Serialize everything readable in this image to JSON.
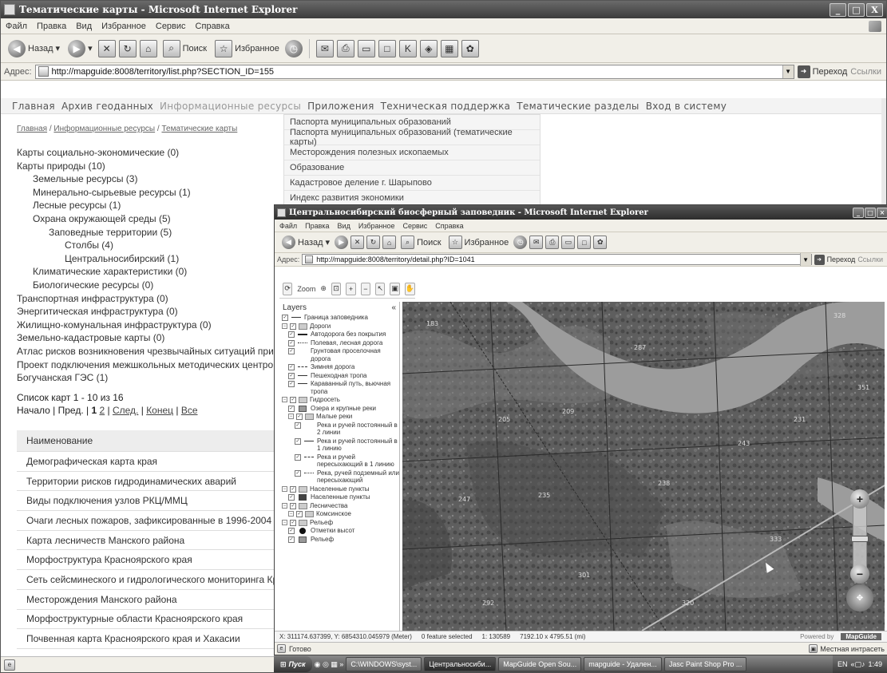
{
  "main_window": {
    "title": "Тематические карты - Microsoft Internet Explorer",
    "menu": [
      "Файл",
      "Правка",
      "Вид",
      "Избранное",
      "Сервис",
      "Справка"
    ],
    "toolbar": {
      "back": "Назад",
      "search": "Поиск",
      "favorites": "Избранное"
    },
    "address_label": "Адрес:",
    "address": "http://mapguide:8008/territory/list.php?SECTION_ID=155",
    "go": "Переход",
    "links": "Ссылки",
    "status": ""
  },
  "site_nav": [
    "Главная",
    "Архив геоданных",
    "Информационные ресурсы",
    "Приложения",
    "Техническая поддержка",
    "Тематические разделы",
    "Вход в систему"
  ],
  "breadcrumb": [
    "Главная",
    "Информационные ресурсы",
    "Тематические карты"
  ],
  "breadcrumb_sep": " / ",
  "dropdown": [
    "Паспорта муниципальных образований",
    "Паспорта муниципальных образований (тематические карты)",
    "Месторождения полезных ископаемых",
    "Образование",
    "Кадастровое деление г. Шарыпово",
    "Индекс развития экономики"
  ],
  "tree": [
    {
      "level": 0,
      "text": "Карты социально-экономические (0)"
    },
    {
      "level": 0,
      "text": "Карты природы (10)"
    },
    {
      "level": 1,
      "text": "Земельные ресурсы (3)"
    },
    {
      "level": 1,
      "text": "Минерально-сырьевые ресурсы (1)"
    },
    {
      "level": 1,
      "text": "Лесные ресурсы (1)"
    },
    {
      "level": 1,
      "text": "Охрана окружающей среды (5)"
    },
    {
      "level": 2,
      "text": "Заповедные территории (5)"
    },
    {
      "level": 3,
      "text": "Столбы (4)"
    },
    {
      "level": 3,
      "text": "Центральносибирский (1)"
    },
    {
      "level": 1,
      "text": "Климатические характеристики (0)"
    },
    {
      "level": 1,
      "text": "Биологические ресурсы (0)"
    },
    {
      "level": 0,
      "text": "Транспортная инфраструктура (0)"
    },
    {
      "level": 0,
      "text": "Энергитическая инфраструктура (0)"
    },
    {
      "level": 0,
      "text": "Жилищно-комунальная инфраструктура (0)"
    },
    {
      "level": 0,
      "text": "Земельно-кадастровые карты (0)"
    },
    {
      "level": 0,
      "text": "Атлас рисков возникновения чрезвычайных ситуаций при"
    },
    {
      "level": 0,
      "text": "Проект подключения межшкольных методических центро"
    },
    {
      "level": 0,
      "text": "Богучанская ГЭС (1)"
    }
  ],
  "pagination": {
    "summary": "Список карт 1 - 10 из 16",
    "first": "Начало",
    "prev": "Пред.",
    "current": "1",
    "page2": "2",
    "next": "След.",
    "last": "Конец",
    "all": "Все"
  },
  "table": {
    "header": "Наименование",
    "rows": [
      "Демографическая карта края",
      "Территории рисков гидродинамических аварий",
      "Виды подключения узлов РКЦ/ММЦ",
      "Очаги лесных пожаров, зафиксированные в 1996-2004 гг",
      "Карта лесничеств Манского района",
      "Морфоструктура Красноярского края",
      "Сеть сейсминеского и гидрологического мониторинга Кр",
      "Месторождения Манского района",
      "Морфоструктурные области Красноярского края",
      "Почвенная карта Красноярского края и Хакасии"
    ]
  },
  "front_window": {
    "title": "Центральносибирский биосферный заповедник - Microsoft Internet Explorer",
    "menu": [
      "Файл",
      "Правка",
      "Вид",
      "Избранное",
      "Сервис",
      "Справка"
    ],
    "toolbar": {
      "back": "Назад",
      "search": "Поиск",
      "favorites": "Избранное"
    },
    "address_label": "Адрес:",
    "address": "http://mapguide:8008/territory/detail.php?ID=1041",
    "go": "Переход",
    "links": "Ссылки",
    "zoom_label": "Zoom",
    "layers_title": "Layers",
    "layers": [
      {
        "indent": 0,
        "sym": "line",
        "text": "Граница заповедника"
      },
      {
        "indent": 0,
        "sym": "group",
        "text": "Дороги"
      },
      {
        "indent": 1,
        "sym": "thick",
        "text": "Автодорога без покрытия"
      },
      {
        "indent": 1,
        "sym": "dot",
        "text": "Полевая, лесная дорога"
      },
      {
        "indent": 1,
        "sym": "none",
        "text": "Грунтовая проселочная дорога"
      },
      {
        "indent": 1,
        "sym": "dash",
        "text": "Зимняя дорога"
      },
      {
        "indent": 1,
        "sym": "line",
        "text": "Пешеходная тропа"
      },
      {
        "indent": 1,
        "sym": "line",
        "text": "Караванный путь, вьючная тропа"
      },
      {
        "indent": 0,
        "sym": "folder",
        "text": "Гидросеть"
      },
      {
        "indent": 1,
        "sym": "box",
        "text": "Озера и крупные реки"
      },
      {
        "indent": 1,
        "sym": "group",
        "text": "Малые реки"
      },
      {
        "indent": 2,
        "sym": "none",
        "text": "Река и ручей постоянный в 2 линии"
      },
      {
        "indent": 2,
        "sym": "line",
        "text": "Река и ручей постоянный в 1 линию"
      },
      {
        "indent": 2,
        "sym": "dash",
        "text": "Река и ручей пересыхающий в 1 линию"
      },
      {
        "indent": 2,
        "sym": "dot",
        "text": "Река, ручей подземный или пересыхающий"
      },
      {
        "indent": 0,
        "sym": "folder",
        "text": "Населенные пункты"
      },
      {
        "indent": 1,
        "sym": "dark",
        "text": "Населенные пункты"
      },
      {
        "indent": 0,
        "sym": "folder",
        "text": "Лесничества"
      },
      {
        "indent": 1,
        "sym": "folder",
        "text": "Комсинское"
      },
      {
        "indent": 0,
        "sym": "folder",
        "text": "Рельеф"
      },
      {
        "indent": 1,
        "sym": "circ",
        "text": "Отметки высот"
      },
      {
        "indent": 1,
        "sym": "box",
        "text": "Рельеф"
      }
    ],
    "status": {
      "coords": "X: 311174.637399, Y: 6854310.045979 (Meter)",
      "selected": "0 feature selected",
      "scale": "1: 130589",
      "size": "7192.10 x 4795.51 (mi)",
      "powered_by": "Powered by",
      "brand": "MapGuide"
    },
    "bottom_status": "Готово",
    "zone": "Местная интрасеть"
  },
  "taskbar": {
    "start": "Пуск",
    "items": [
      {
        "label": "C:\\WINDOWS\\syst...",
        "active": false
      },
      {
        "label": "Центральносиби...",
        "active": true
      },
      {
        "label": "MapGuide Open Sou...",
        "active": false
      },
      {
        "label": "mapguide - Удален...",
        "active": false
      },
      {
        "label": "Jasc Paint Shop Pro ...",
        "active": false
      }
    ],
    "lang": "EN",
    "clock": "1:49"
  },
  "colors": {
    "title_gradient": "#4a4a4a",
    "map_base": "#5a5a5a",
    "river": "#9a9a9a"
  }
}
